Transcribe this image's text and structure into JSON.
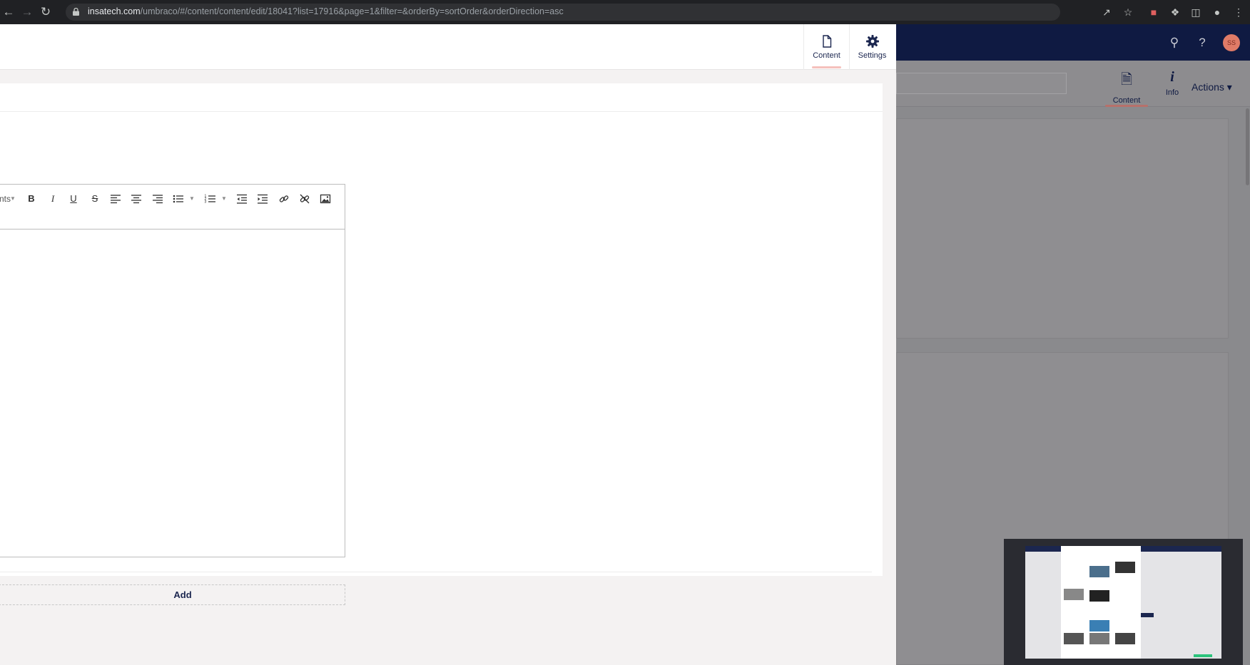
{
  "browser": {
    "url_host": "insatech.com",
    "url_path": "/umbraco/#/content/content/edit/18041?list=17916&page=1&filter=&orderBy=sortOrder&orderDirection=asc"
  },
  "overlay": {
    "tabs": [
      {
        "label": "Content",
        "icon": "document-icon",
        "active": true
      },
      {
        "label": "Settings",
        "icon": "gear-icon",
        "active": false
      }
    ],
    "editor": {
      "format_dropdown_label": "nts",
      "toolbar_icons": [
        "bold-icon",
        "italic-icon",
        "underline-icon",
        "strikethrough-icon",
        "align-left-icon",
        "align-center-icon",
        "align-right-icon",
        "bullet-list-icon",
        "numbered-list-icon",
        "outdent-icon",
        "indent-icon",
        "link-icon",
        "unlink-icon",
        "image-icon"
      ],
      "toolbar_glyphs": {
        "bold": "B",
        "italic": "I",
        "underline": "U",
        "strike": "S"
      }
    },
    "add_label": "Add"
  },
  "background_app": {
    "avatar_initials": "SS",
    "sub_apps": [
      {
        "label": "Content",
        "icon": "document-icon",
        "active": true
      },
      {
        "label": "Info",
        "icon": "info-icon",
        "active": false
      }
    ],
    "actions_label": "Actions",
    "accent_color": "#f5c1bc",
    "header_color": "#0f1a42"
  }
}
